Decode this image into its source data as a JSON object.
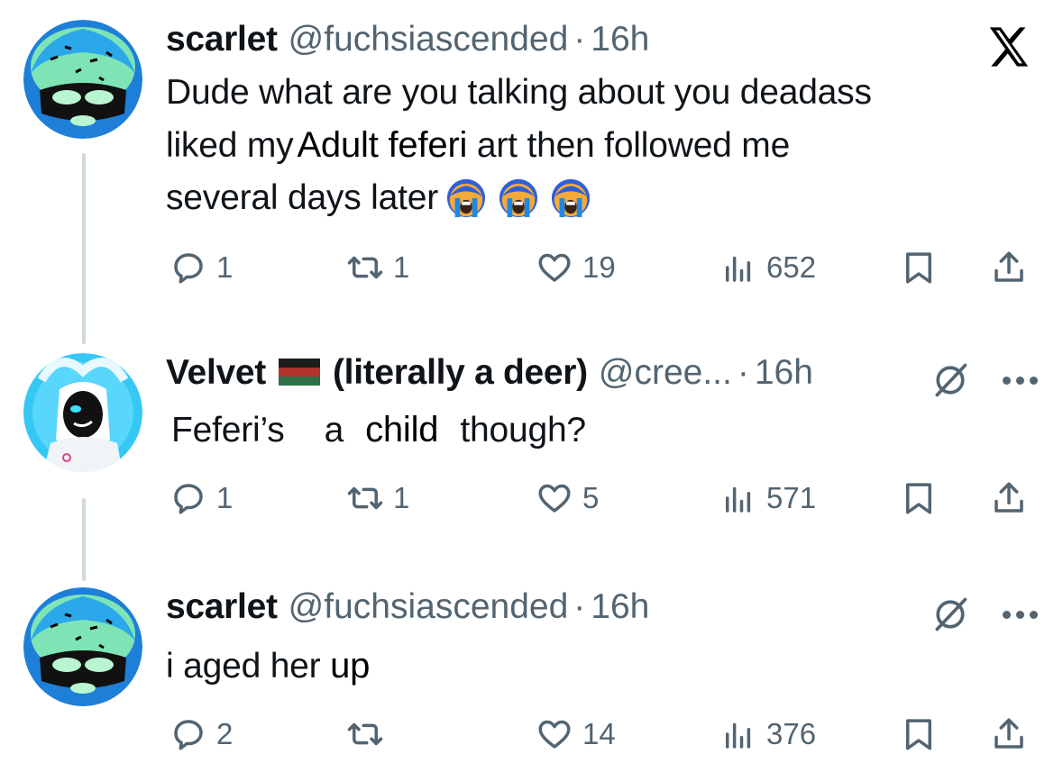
{
  "platform_logo": "x-logo",
  "tweets": [
    {
      "display_name": "scarlet",
      "handle": "@fuchsiascended",
      "separator": "·",
      "time": "16h",
      "body": {
        "line1": "Dude what are you talking about you deadass",
        "line2_a": "liked my",
        "line2_b": "Adult feferi",
        "line2_c": "art then followed me",
        "line3": "several days later"
      },
      "emojis": [
        "loudly-crying-face",
        "loudly-crying-face",
        "loudly-crying-face"
      ],
      "stats": {
        "replies": "1",
        "reposts": "1",
        "likes": "19",
        "views": "652"
      }
    },
    {
      "display_name_a": "Velvet",
      "flag": "flag-icon",
      "display_name_b": "(literally a deer)",
      "handle": "@cree...",
      "separator": "·",
      "time": "16h",
      "body": {
        "w1": "Feferi’s",
        "w2": "a",
        "w3": "child",
        "w4": "though?"
      },
      "stats": {
        "replies": "1",
        "reposts": "1",
        "likes": "5",
        "views": "571"
      }
    },
    {
      "display_name": "scarlet",
      "handle": "@fuchsiascended",
      "separator": "·",
      "time": "16h",
      "body": {
        "a": "i aged her",
        "b": "up"
      },
      "stats": {
        "replies": "2",
        "reposts": "",
        "likes": "14",
        "views": "376"
      }
    }
  ],
  "colors": {
    "text": "#0f1419",
    "secondary": "#536471",
    "thread_line": "#cfd9de",
    "flag": [
      "#1d1d1b",
      "#b3322b",
      "#2f6f48"
    ]
  }
}
